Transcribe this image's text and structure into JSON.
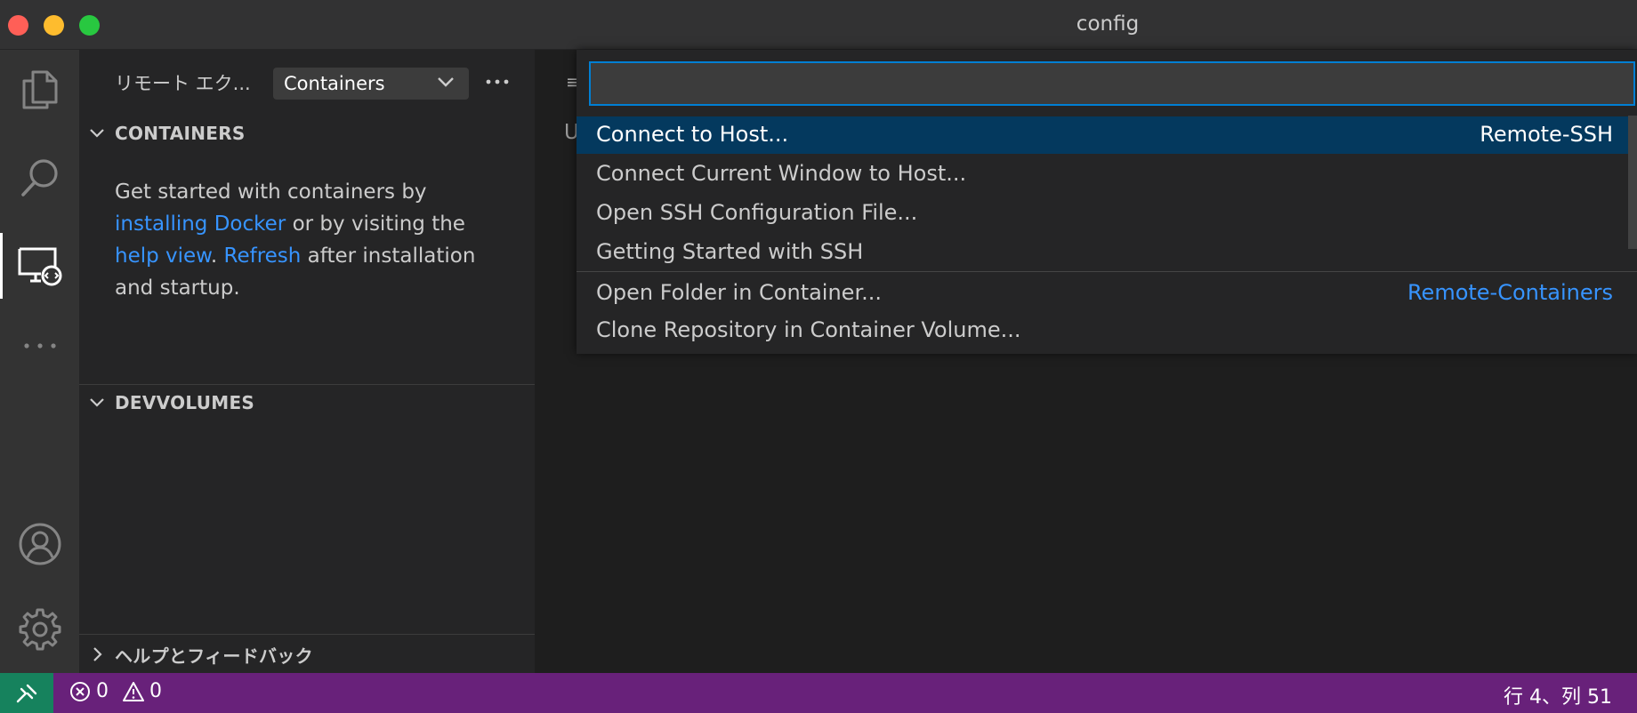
{
  "window": {
    "title": "config"
  },
  "activitybar": {
    "items": [
      {
        "icon": "explorer-icon"
      },
      {
        "icon": "search-icon"
      },
      {
        "icon": "remote-explorer-icon",
        "active": true
      },
      {
        "icon": "more-icon"
      },
      {
        "icon": "account-icon"
      },
      {
        "icon": "settings-gear-icon"
      }
    ]
  },
  "sidebar": {
    "title": "リモート エク...",
    "select_value": "Containers",
    "sections": {
      "containers": "CONTAINERS",
      "devvolumes": "DEVVOLUMES",
      "help": "ヘルプとフィードバック"
    },
    "welcome": {
      "t1": "Get started with containers by ",
      "link1": "installing Docker",
      "t2": " or by visiting the ",
      "link2": "help view",
      "t3": ". ",
      "link3": "Refresh",
      "t4": " after installation and startup."
    }
  },
  "editor": {
    "peek1": "≡",
    "peek2": "U"
  },
  "quickpick": {
    "input_value": "",
    "items": [
      {
        "label": "Connect to Host...",
        "detail": "Remote-SSH",
        "selected": true
      },
      {
        "label": "Connect Current Window to Host...",
        "detail": ""
      },
      {
        "label": "Open SSH Configuration File...",
        "detail": ""
      },
      {
        "label": "Getting Started with SSH",
        "detail": ""
      },
      {
        "label": "Open Folder in Container...",
        "detail": "Remote-Containers"
      },
      {
        "label": "Clone Repository in Container Volume...",
        "detail": ""
      }
    ]
  },
  "statusbar": {
    "errors": "0",
    "warnings": "0",
    "cursor": "行 4、列 51"
  },
  "colors": {
    "accent": "#007fd4",
    "statusbar": "#68217a",
    "remote": "#16825d",
    "link": "#3794ff"
  }
}
